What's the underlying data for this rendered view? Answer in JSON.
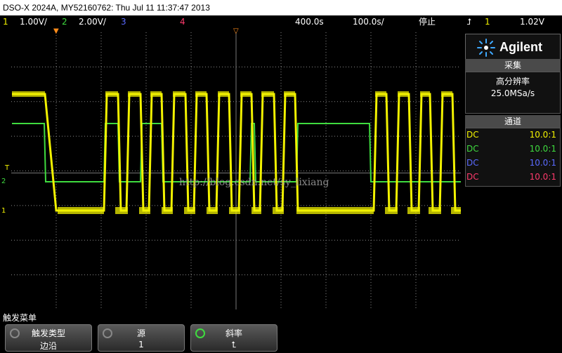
{
  "title": "DSO-X 2024A, MY52160762: Thu Jul 11 11:37:47 2013",
  "status": {
    "ch1_num": "1",
    "ch1_scale": "1.00V/",
    "ch2_num": "2",
    "ch2_scale": "2.00V/",
    "ch3_num": "3",
    "ch4_num": "4",
    "timebase": "400.0s",
    "delay": "100.0s/",
    "run_state": "停止",
    "trig_ch": "1",
    "trig_level": "1.02V"
  },
  "panel": {
    "brand": "Agilent",
    "acq_header": "采集",
    "acq_mode": "高分辨率",
    "acq_rate": "25.0MSa/s",
    "chan_header": "通道",
    "channels": [
      {
        "coupling": "DC",
        "probe": "10.0:1",
        "color": "#f2f200"
      },
      {
        "coupling": "DC",
        "probe": "10.0:1",
        "color": "#3fdc3f"
      },
      {
        "coupling": "DC",
        "probe": "10.0:1",
        "color": "#5a6aff"
      },
      {
        "coupling": "DC",
        "probe": "10.0:1",
        "color": "#ff3a6c"
      }
    ]
  },
  "markers": {
    "ch2": "2",
    "ch1": "1",
    "trig": "T"
  },
  "watermark": "http://blog.csdn.net/sy_lixiang",
  "menu": {
    "title": "触发菜单",
    "keys": [
      {
        "label": "触发类型",
        "value": "边沿"
      },
      {
        "label": "源",
        "value": "1"
      },
      {
        "label": "斜率",
        "value": "⮤"
      }
    ]
  },
  "colors": {
    "ch1": "#f2f200",
    "ch2": "#3fdc3f",
    "grid": "#8a8a8a"
  }
}
